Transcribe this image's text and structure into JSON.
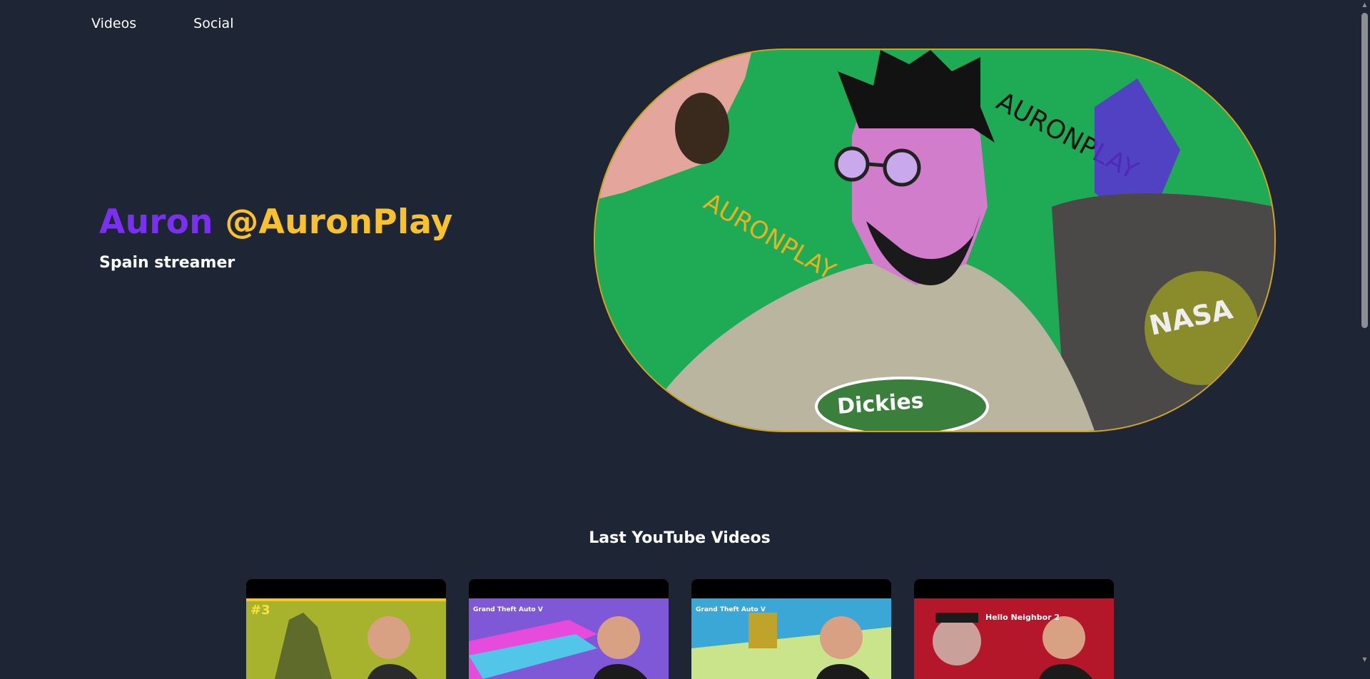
{
  "nav": {
    "items": [
      {
        "label": "Videos"
      },
      {
        "label": "Social"
      }
    ]
  },
  "hero": {
    "name": "Auron",
    "handle": "@AuronPlay",
    "subtitle": "Spain streamer"
  },
  "avatar": {
    "artwork": "illustrated-portrait",
    "tag_left": "AURONPLAY",
    "tag_right": "AURONPLAY",
    "hoodie_logo": "Dickies",
    "shirt_logo": "NASA"
  },
  "videos": {
    "title": "Last YouTube Videos",
    "items": [
      {
        "badge": "#3",
        "theme": "#a7b32c"
      },
      {
        "badge": "Grand Theft Auto V",
        "theme": "#7e58d6"
      },
      {
        "badge": "Grand Theft Auto V",
        "theme": "#3aa7d7"
      },
      {
        "badge": "Hello Neighbor 2",
        "theme": "#b5172a"
      }
    ]
  },
  "colors": {
    "background": "#1e2635",
    "accent_purple": "#7b2ff0",
    "accent_yellow": "#f9c22c"
  }
}
